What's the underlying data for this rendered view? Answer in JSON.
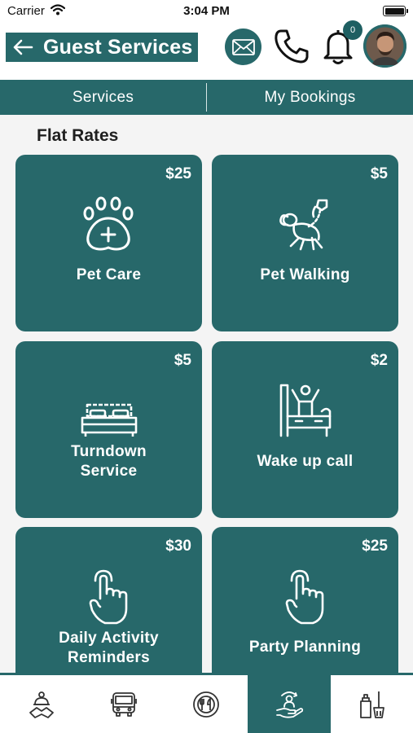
{
  "status_bar": {
    "carrier": "Carrier",
    "time": "3:04 PM"
  },
  "header": {
    "title": "Guest Services",
    "notification_count": "0",
    "icons": [
      "back-arrow-icon",
      "mail-icon",
      "phone-icon",
      "bell-icon",
      "avatar"
    ]
  },
  "tabs": [
    {
      "label": "Services"
    },
    {
      "label": "My Bookings"
    }
  ],
  "section": {
    "title": "Flat Rates"
  },
  "services": [
    {
      "price": "$25",
      "label": "Pet Care",
      "icon": "paw-plus-icon"
    },
    {
      "price": "$5",
      "label": "Pet Walking",
      "icon": "dog-walking-icon"
    },
    {
      "price": "$5",
      "label_line1": "Turndown",
      "label_line2": "Service",
      "icon": "bed-icon"
    },
    {
      "price": "$2",
      "label": "Wake up call",
      "icon": "wake-up-icon"
    },
    {
      "price": "$30",
      "label_line1": "Daily Activity",
      "label_line2": "Reminders",
      "icon": "tap-hand-icon"
    },
    {
      "price": "$25",
      "label": "Party Planning",
      "icon": "tap-hand-icon"
    }
  ],
  "bottom_nav": [
    {
      "icon": "concierge-icon",
      "active": false
    },
    {
      "icon": "bus-icon",
      "active": false
    },
    {
      "icon": "dining-icon",
      "active": false
    },
    {
      "icon": "guest-services-icon",
      "active": true
    },
    {
      "icon": "housekeeping-icon",
      "active": false
    }
  ],
  "colors": {
    "primary": "#27686a",
    "background": "#f4f4f4",
    "text": "#1f1f1f"
  }
}
